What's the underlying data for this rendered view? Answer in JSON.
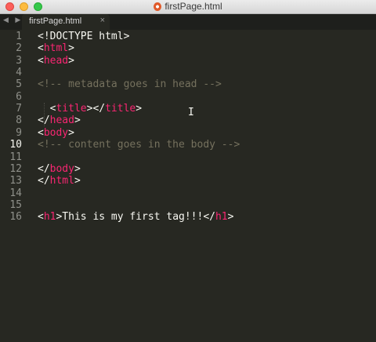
{
  "window": {
    "title": "firstPage.html"
  },
  "tab": {
    "label": "firstPage.html",
    "close": "×"
  },
  "nav": {
    "arrows": "◀ ▶"
  },
  "editor": {
    "current_line": 10,
    "lines": [
      {
        "n": "1",
        "segs": [
          [
            "p",
            "<!DOCTYPE html>"
          ]
        ]
      },
      {
        "n": "2",
        "segs": [
          [
            "p",
            "<"
          ],
          [
            "t",
            "html"
          ],
          [
            "p",
            ">"
          ]
        ]
      },
      {
        "n": "3",
        "segs": [
          [
            "p",
            "<"
          ],
          [
            "t",
            "head"
          ],
          [
            "p",
            ">"
          ]
        ]
      },
      {
        "n": "4",
        "segs": []
      },
      {
        "n": "5",
        "segs": [
          [
            "c",
            "<!-- metadata goes in head -->"
          ]
        ]
      },
      {
        "n": "6",
        "segs": []
      },
      {
        "n": "7",
        "segs": [
          [
            "p",
            "  <"
          ],
          [
            "t",
            "title"
          ],
          [
            "p",
            "></"
          ],
          [
            "t",
            "title"
          ],
          [
            "p",
            ">"
          ]
        ]
      },
      {
        "n": "8",
        "segs": [
          [
            "p",
            "</"
          ],
          [
            "t",
            "head"
          ],
          [
            "p",
            ">"
          ]
        ]
      },
      {
        "n": "9",
        "segs": [
          [
            "p",
            "<"
          ],
          [
            "t",
            "body"
          ],
          [
            "p",
            ">"
          ]
        ]
      },
      {
        "n": "10",
        "segs": [
          [
            "c",
            "<!-- content goes in the body -->"
          ]
        ]
      },
      {
        "n": "11",
        "segs": []
      },
      {
        "n": "12",
        "segs": [
          [
            "p",
            "</"
          ],
          [
            "t",
            "body"
          ],
          [
            "p",
            ">"
          ]
        ]
      },
      {
        "n": "13",
        "segs": [
          [
            "p",
            "</"
          ],
          [
            "t",
            "html"
          ],
          [
            "p",
            ">"
          ]
        ]
      },
      {
        "n": "14",
        "segs": []
      },
      {
        "n": "15",
        "segs": []
      },
      {
        "n": "16",
        "segs": [
          [
            "p",
            "<"
          ],
          [
            "t",
            "h1"
          ],
          [
            "p",
            ">This is my first tag!!!</"
          ],
          [
            "t",
            "h1"
          ],
          [
            "p",
            ">"
          ]
        ]
      }
    ]
  }
}
